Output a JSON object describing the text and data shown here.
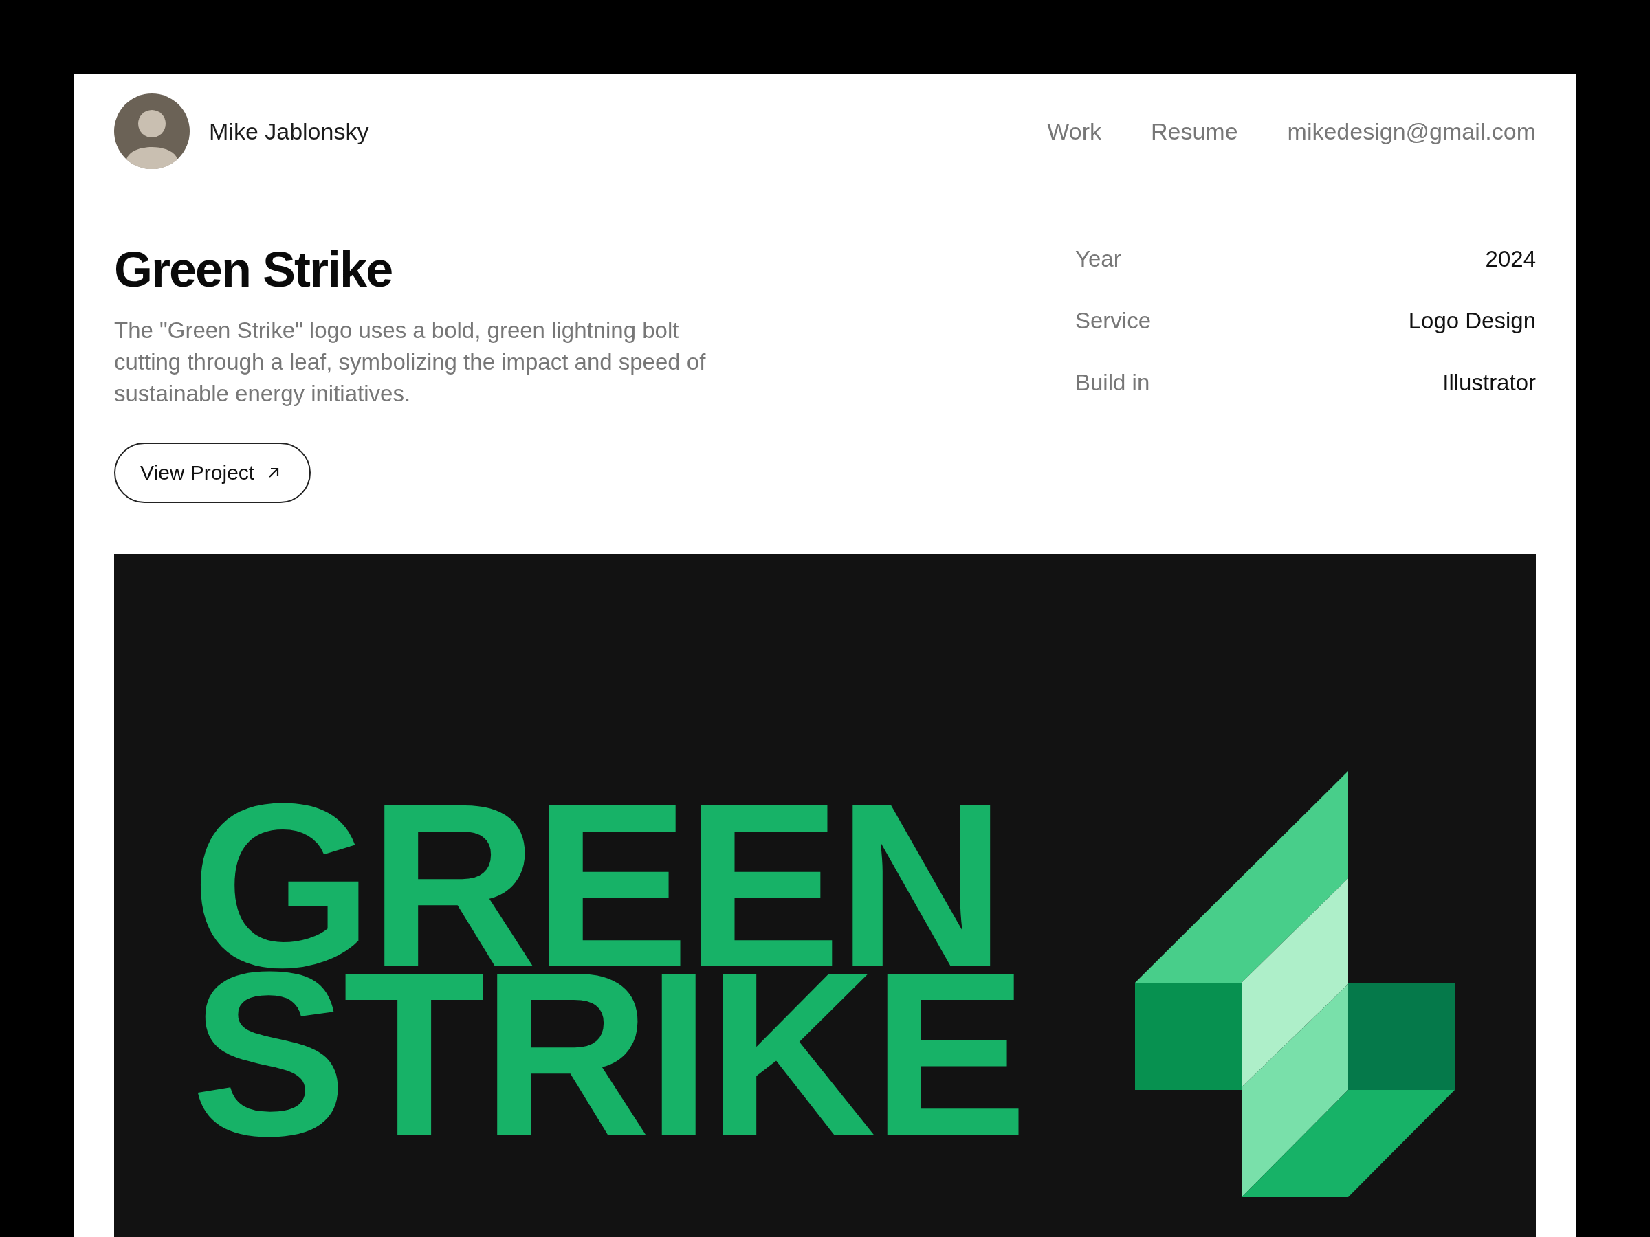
{
  "header": {
    "name": "Mike Jablonsky",
    "nav": [
      {
        "label": "Work"
      },
      {
        "label": "Resume"
      },
      {
        "label": "mikedesign@gmail.com"
      }
    ]
  },
  "project": {
    "title": "Green Strike",
    "description": "The \"Green Strike\" logo uses a bold, green lightning bolt cutting through a leaf, symbolizing the impact and speed of sustainable energy initiatives.",
    "button": "View Project"
  },
  "details": [
    {
      "label": "Year",
      "value": "2024"
    },
    {
      "label": "Service",
      "value": "Logo Design"
    },
    {
      "label": "Build in",
      "value": "Illustrator"
    }
  ],
  "artwork": {
    "wordmark": [
      "GREEN",
      "STRIKE"
    ]
  }
}
